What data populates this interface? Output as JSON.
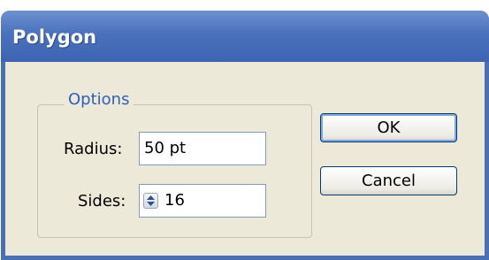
{
  "dialog": {
    "title": "Polygon",
    "group_label": "Options",
    "radius_label": "Radius:",
    "radius_value": "50 pt",
    "sides_label": "Sides:",
    "sides_value": "16",
    "ok_label": "OK",
    "cancel_label": "Cancel"
  },
  "icons": {
    "spinner": "up-down-arrows-icon"
  },
  "colors": {
    "titlebar": "#4a71bc",
    "client_bg": "#ece9d8",
    "group_label": "#2f5fb8",
    "button_border": "#003c74"
  }
}
